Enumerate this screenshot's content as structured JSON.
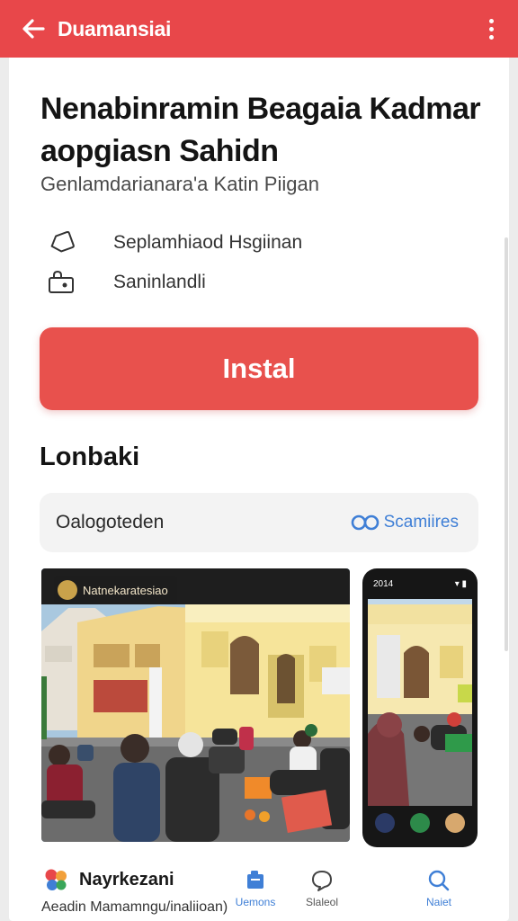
{
  "appbar": {
    "title": "Duamansiai",
    "back_icon": "arrow-left-icon",
    "more_icon": "more-vert-icon",
    "color": "#e8474a"
  },
  "app": {
    "title": "Nenabinramin Beagaia Kadmar aopgiasn Sahidn",
    "subtitle": "Genlamdarianara'a Katin Piigan",
    "meta": [
      {
        "icon": "tag-icon",
        "text": "Seplamhiaod Hsgiinan"
      },
      {
        "icon": "user-lock-icon",
        "text": "Saninlandli"
      }
    ]
  },
  "install": {
    "label": "Instal",
    "color": "#e8514d"
  },
  "section": {
    "heading": "Lonbaki"
  },
  "filter": {
    "left_label": "Oalogoteden",
    "right_label": "Scamiires",
    "right_icon": "infinity-icon",
    "accent": "#3f7fd6"
  },
  "screenshots": {
    "shot1_label": "Natnekaratesiao",
    "phone_time": "2014"
  },
  "bottom": {
    "app_name": "Nayrkezani",
    "app_sub": "Aeadin Mamamngu/inaliioan)",
    "tabs": [
      {
        "icon": "apps-icon",
        "label": "Uemons"
      },
      {
        "icon": "chat-icon",
        "label": "Slaleol"
      },
      {
        "icon": "search-icon",
        "label": "Naiet"
      }
    ]
  }
}
